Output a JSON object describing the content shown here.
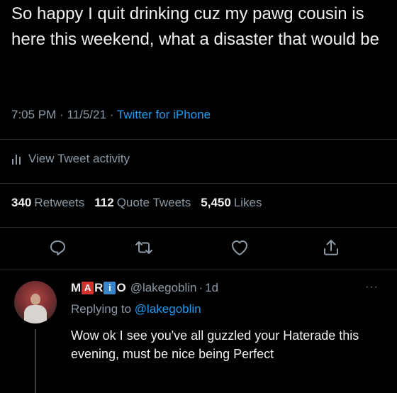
{
  "tweet": {
    "text": "So happy I quit drinking cuz my pawg cousin is here this weekend, what a disaster that would be",
    "time": "7:05 PM",
    "date": "11/5/21",
    "separator": "·",
    "source": "Twitter for iPhone"
  },
  "activity": {
    "label": "View Tweet activity",
    "icon": "bar-chart-icon"
  },
  "stats": {
    "retweets_count": "340",
    "retweets_label": "Retweets",
    "quotes_count": "112",
    "quotes_label": "Quote Tweets",
    "likes_count": "5,450",
    "likes_label": "Likes"
  },
  "actions": [
    {
      "name": "reply",
      "icon": "reply-icon"
    },
    {
      "name": "retweet",
      "icon": "retweet-icon"
    },
    {
      "name": "like",
      "icon": "heart-icon"
    },
    {
      "name": "share",
      "icon": "share-icon"
    }
  ],
  "reply": {
    "name_letters": {
      "m": "M",
      "a": "A",
      "r": "R",
      "i": "i",
      "o": "O"
    },
    "handle": "@lakegoblin",
    "separator": "·",
    "age": "1d",
    "more": "···",
    "replying_prefix": "Replying to",
    "replying_handle": "@lakegoblin",
    "text": "Wow ok I see you've all guzzled your Haterade this evening, must be nice being Perfect"
  },
  "colors": {
    "background": "#000000",
    "text": "#eef0f1",
    "secondary": "#8b98a5",
    "accent": "#1d9bf0",
    "name_box_red": "#d4322c",
    "name_box_blue": "#3a86c9"
  }
}
